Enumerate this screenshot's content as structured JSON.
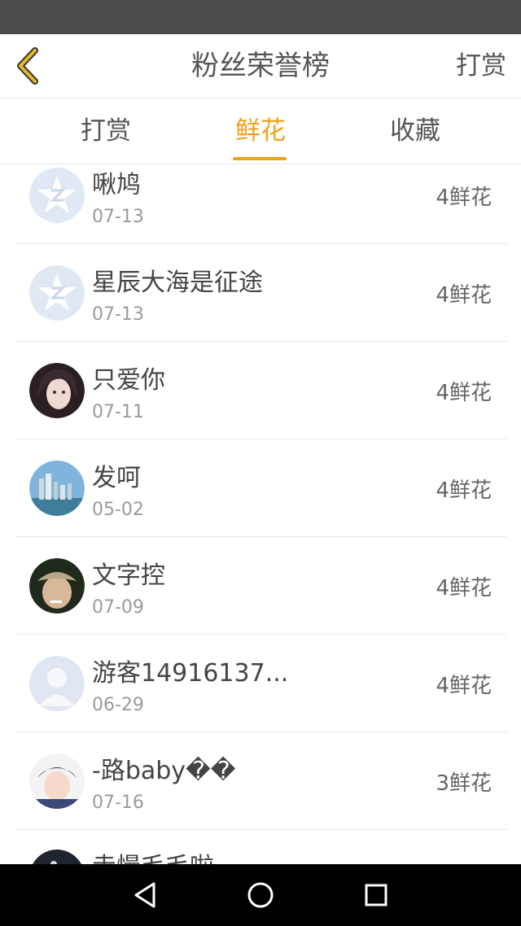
{
  "header": {
    "title": "粉丝荣誉榜",
    "action_label": "打赏",
    "back_icon": "chevron-left-icon"
  },
  "tabs": [
    {
      "label": "打赏",
      "active": false
    },
    {
      "label": "鲜花",
      "active": true
    },
    {
      "label": "收藏",
      "active": false
    }
  ],
  "colors": {
    "accent": "#f0a11a",
    "status_bar": "#4a4a4a",
    "nav_bar": "#000000"
  },
  "fans": [
    {
      "name": "啾鸠",
      "date": "07-13",
      "count": "4鲜花",
      "avatar": "qq-default-avatar-icon"
    },
    {
      "name": "星辰大海是征途",
      "date": "07-13",
      "count": "4鲜花",
      "avatar": "qq-default-avatar-icon"
    },
    {
      "name": "只爱你",
      "date": "07-11",
      "count": "4鲜花",
      "avatar": "photo-avatar"
    },
    {
      "name": "发呵",
      "date": "05-02",
      "count": "4鲜花",
      "avatar": "cityscape-avatar"
    },
    {
      "name": "文字控",
      "date": "07-09",
      "count": "4鲜花",
      "avatar": "photo-avatar"
    },
    {
      "name": "游客14916137...",
      "date": "06-29",
      "count": "4鲜花",
      "avatar": "default-person-avatar-icon"
    },
    {
      "name": "-路baby��",
      "date": "07-16",
      "count": "3鲜花",
      "avatar": "photo-avatar"
    },
    {
      "name": "走慢毛毛啦",
      "date": "",
      "count": "",
      "avatar": "photo-avatar"
    }
  ],
  "nav": [
    "back-triangle-icon",
    "home-circle-icon",
    "recents-square-icon"
  ]
}
